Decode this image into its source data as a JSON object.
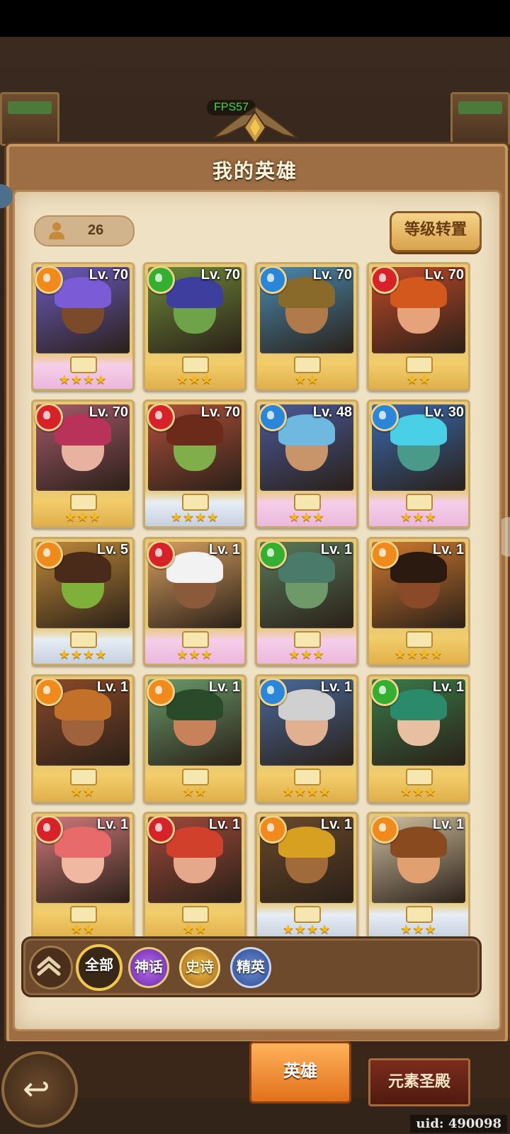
{
  "fps_label": "FPS57",
  "title": "我的英雄",
  "hero_count": "26",
  "reset_button": "等级转置",
  "heroes": [
    {
      "level": "Lv. 70",
      "stars": 4,
      "element": "fire-orange",
      "frame": "pink",
      "skin": "#7a4a2a",
      "hair": "#7b5bd6",
      "bg": "#6b5bbf"
    },
    {
      "level": "Lv. 70",
      "stars": 3,
      "element": "nature-green",
      "frame": "gold",
      "skin": "#6fa34a",
      "hair": "#3e3e9e",
      "bg": "#6d8a3a"
    },
    {
      "level": "Lv. 70",
      "stars": 2,
      "element": "water-blue",
      "frame": "gold",
      "skin": "#b07a4a",
      "hair": "#8a6a2a",
      "bg": "#4a8ab0"
    },
    {
      "level": "Lv. 70",
      "stars": 2,
      "element": "fire-red",
      "frame": "gold",
      "skin": "#e6a27a",
      "hair": "#d2581e",
      "bg": "#c04a2a"
    },
    {
      "level": "Lv. 70",
      "stars": 3,
      "element": "fire-red",
      "frame": "gold",
      "skin": "#e7b3a0",
      "hair": "#b8325a",
      "bg": "#a55a6a"
    },
    {
      "level": "Lv. 70",
      "stars": 4,
      "element": "fire-red",
      "frame": "silver",
      "skin": "#7fae4a",
      "hair": "#6b2a1a",
      "bg": "#b0503a"
    },
    {
      "level": "Lv. 48",
      "stars": 3,
      "element": "water-blue",
      "frame": "pink",
      "skin": "#c8956a",
      "hair": "#6fb8e0",
      "bg": "#4a5a9a"
    },
    {
      "level": "Lv. 30",
      "stars": 3,
      "element": "water-blue",
      "frame": "pink",
      "skin": "#4a9a8a",
      "hair": "#4ad0e6",
      "bg": "#3a6ab0"
    },
    {
      "level": "Lv. 5",
      "stars": 4,
      "element": "fire-orange",
      "frame": "silver",
      "skin": "#7fb03a",
      "hair": "#4a2a18",
      "bg": "#c08a3a"
    },
    {
      "level": "Lv. 1",
      "stars": 3,
      "element": "fire-red",
      "frame": "pink",
      "skin": "#8a5a3a",
      "hair": "#f2f2f2",
      "bg": "#d8a060"
    },
    {
      "level": "Lv. 1",
      "stars": 3,
      "element": "nature-green",
      "frame": "pink",
      "skin": "#6e9a6a",
      "hair": "#4a7a6a",
      "bg": "#5a7a5a"
    },
    {
      "level": "Lv. 1",
      "stars": 4,
      "element": "fire-orange",
      "frame": "gold",
      "skin": "#8a4a2a",
      "hair": "#2a1a10",
      "bg": "#d07a30"
    },
    {
      "level": "Lv. 1",
      "stars": 2,
      "element": "fire-orange",
      "frame": "gold",
      "skin": "#a0623a",
      "hair": "#c2702a",
      "bg": "#8a4a2a"
    },
    {
      "level": "Lv. 1",
      "stars": 2,
      "element": "fire-orange",
      "frame": "gold",
      "skin": "#c8825a",
      "hair": "#2a4a2a",
      "bg": "#6a9a6a"
    },
    {
      "level": "Lv. 1",
      "stars": 4,
      "element": "water-blue",
      "frame": "gold",
      "skin": "#e0b090",
      "hair": "#d0d0d0",
      "bg": "#4a6a9a"
    },
    {
      "level": "Lv. 1",
      "stars": 3,
      "element": "nature-green",
      "frame": "gold",
      "skin": "#e6c0a0",
      "hair": "#2a8a6a",
      "bg": "#3a7a4a"
    },
    {
      "level": "Lv. 1",
      "stars": 2,
      "element": "fire-red",
      "frame": "gold",
      "skin": "#f0b8a0",
      "hair": "#e86a6a",
      "bg": "#d07a7a"
    },
    {
      "level": "Lv. 1",
      "stars": 2,
      "element": "fire-red",
      "frame": "gold",
      "skin": "#e6a88a",
      "hair": "#d0402a",
      "bg": "#a04a3a"
    },
    {
      "level": "Lv. 1",
      "stars": 4,
      "element": "fire-orange",
      "frame": "silver",
      "skin": "#a06a3a",
      "hair": "#d8a020",
      "bg": "#6a4a2a"
    },
    {
      "level": "Lv. 1",
      "stars": 3,
      "element": "fire-orange",
      "frame": "silver",
      "skin": "#e0a070",
      "hair": "#8a4a20",
      "bg": "#d0c0a0"
    }
  ],
  "element_colors": {
    "fire-orange": "#f08a1a",
    "fire-red": "#d8222a",
    "water-blue": "#2a86d8",
    "nature-green": "#34b030"
  },
  "filters": {
    "collapse_icon": "double-chevron-up-icon",
    "all": "全部",
    "myth": "神话",
    "epic": "史诗",
    "elite": "精英"
  },
  "tabs": {
    "hero": "英雄",
    "temple": "元素圣殿"
  },
  "back_icon": "back-arrow-icon",
  "uid_label": "uid: 490098"
}
